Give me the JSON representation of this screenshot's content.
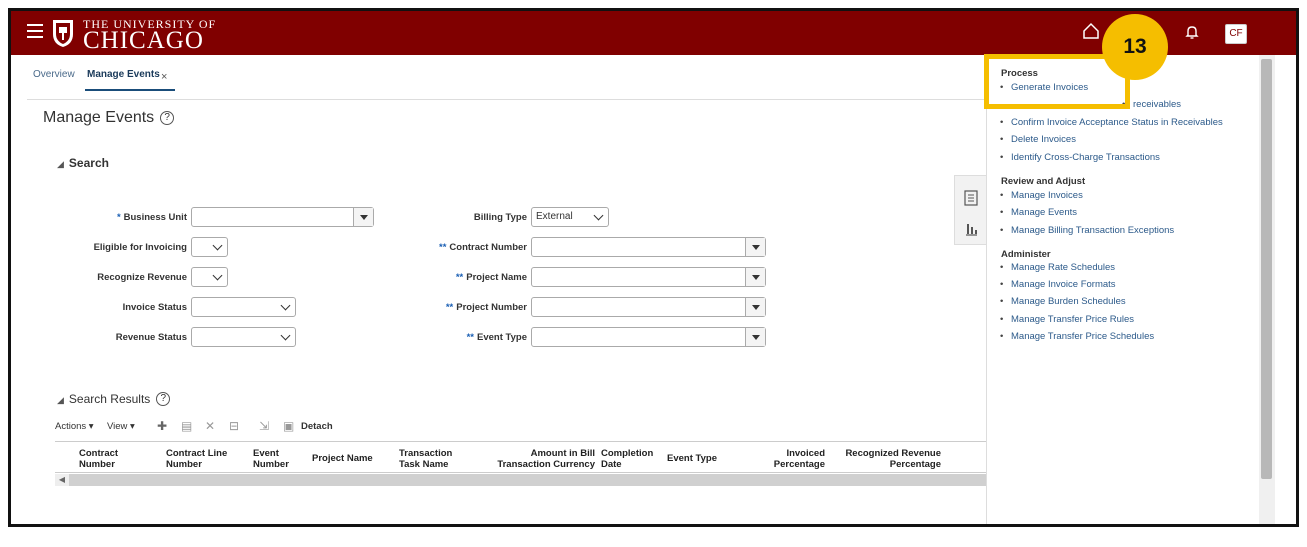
{
  "header": {
    "logo_top": "THE UNIVERSITY OF",
    "logo_main": "CHICAGO",
    "avatar": "CF"
  },
  "tabs": [
    {
      "label": "Overview"
    },
    {
      "label": "Manage Events"
    }
  ],
  "page": {
    "title": "Manage Events",
    "help": "?"
  },
  "search": {
    "header": "Search",
    "business_unit": "Business Unit",
    "eligible_for_invoicing": "Eligible for Invoicing",
    "recognize_revenue": "Recognize Revenue",
    "invoice_status": "Invoice Status",
    "revenue_status": "Revenue Status",
    "billing_type": "Billing Type",
    "billing_type_value": "External",
    "contract_number": "Contract Number",
    "project_name": "Project Name",
    "project_number": "Project Number",
    "event_type": "Event Type",
    "req_single": "*",
    "req_double": "**"
  },
  "results": {
    "header": "Search Results",
    "actions": "Actions ▾",
    "view": "View ▾",
    "detach": "Detach",
    "columns": [
      "Contract Number",
      "Contract Line Number",
      "Event Number",
      "Project Name",
      "Transaction Task Name",
      "Amount in Bill Transaction Currency",
      "Completion Date",
      "Event Type",
      "Invoiced Percentage",
      "Recognized Revenue Percentage"
    ]
  },
  "panel": {
    "process_header": "Process",
    "process_items": [
      "Generate Invoices",
      "receivables",
      "Confirm Invoice Acceptance Status in Receivables",
      "Delete Invoices",
      "Identify Cross-Charge Transactions"
    ],
    "review_header": "Review and Adjust",
    "review_items": [
      "Manage Invoices",
      "Manage Events",
      "Manage Billing Transaction Exceptions"
    ],
    "admin_header": "Administer",
    "admin_items": [
      "Manage Rate Schedules",
      "Manage Invoice Formats",
      "Manage Burden Schedules",
      "Manage Transfer Price Rules",
      "Manage Transfer Price Schedules"
    ]
  },
  "callout": {
    "step": "13",
    "color": "#f5be00"
  },
  "colors": {
    "brand": "#800000",
    "link": "#2c5a8a"
  }
}
